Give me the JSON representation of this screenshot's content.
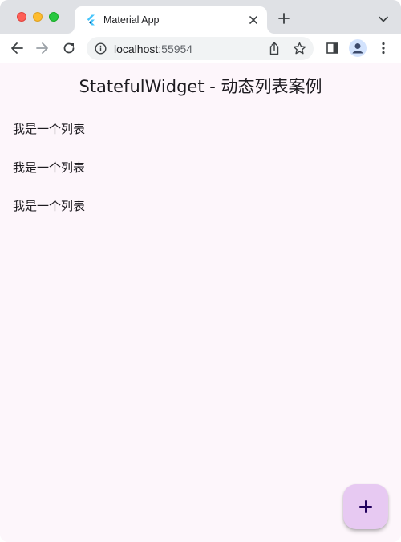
{
  "browser": {
    "tab": {
      "title": "Material App",
      "favicon": "flutter-logo-icon",
      "close_icon": "close-icon"
    },
    "new_tab_icon": "plus-icon",
    "tab_search_icon": "chevron-down-icon",
    "toolbar": {
      "back_icon": "arrow-left-icon",
      "forward_icon": "arrow-right-icon",
      "reload_icon": "reload-icon",
      "url_host": "localhost",
      "url_port": ":55954",
      "site_info_icon": "info-icon",
      "share_icon": "share-icon",
      "bookmark_icon": "star-icon",
      "side_panel_icon": "side-panel-icon",
      "profile_icon": "profile-avatar-icon",
      "menu_icon": "kebab-menu-icon"
    }
  },
  "app": {
    "title": "StatefulWidget - 动态列表案例",
    "items": [
      {
        "label": "我是一个列表"
      },
      {
        "label": "我是一个列表"
      },
      {
        "label": "我是一个列表"
      }
    ],
    "fab": {
      "icon": "plus-icon",
      "color": "#e7c9f2"
    }
  },
  "colors": {
    "background": "#fdf6fb",
    "tabstrip": "#dfe1e5",
    "text": "#1d1b20"
  }
}
